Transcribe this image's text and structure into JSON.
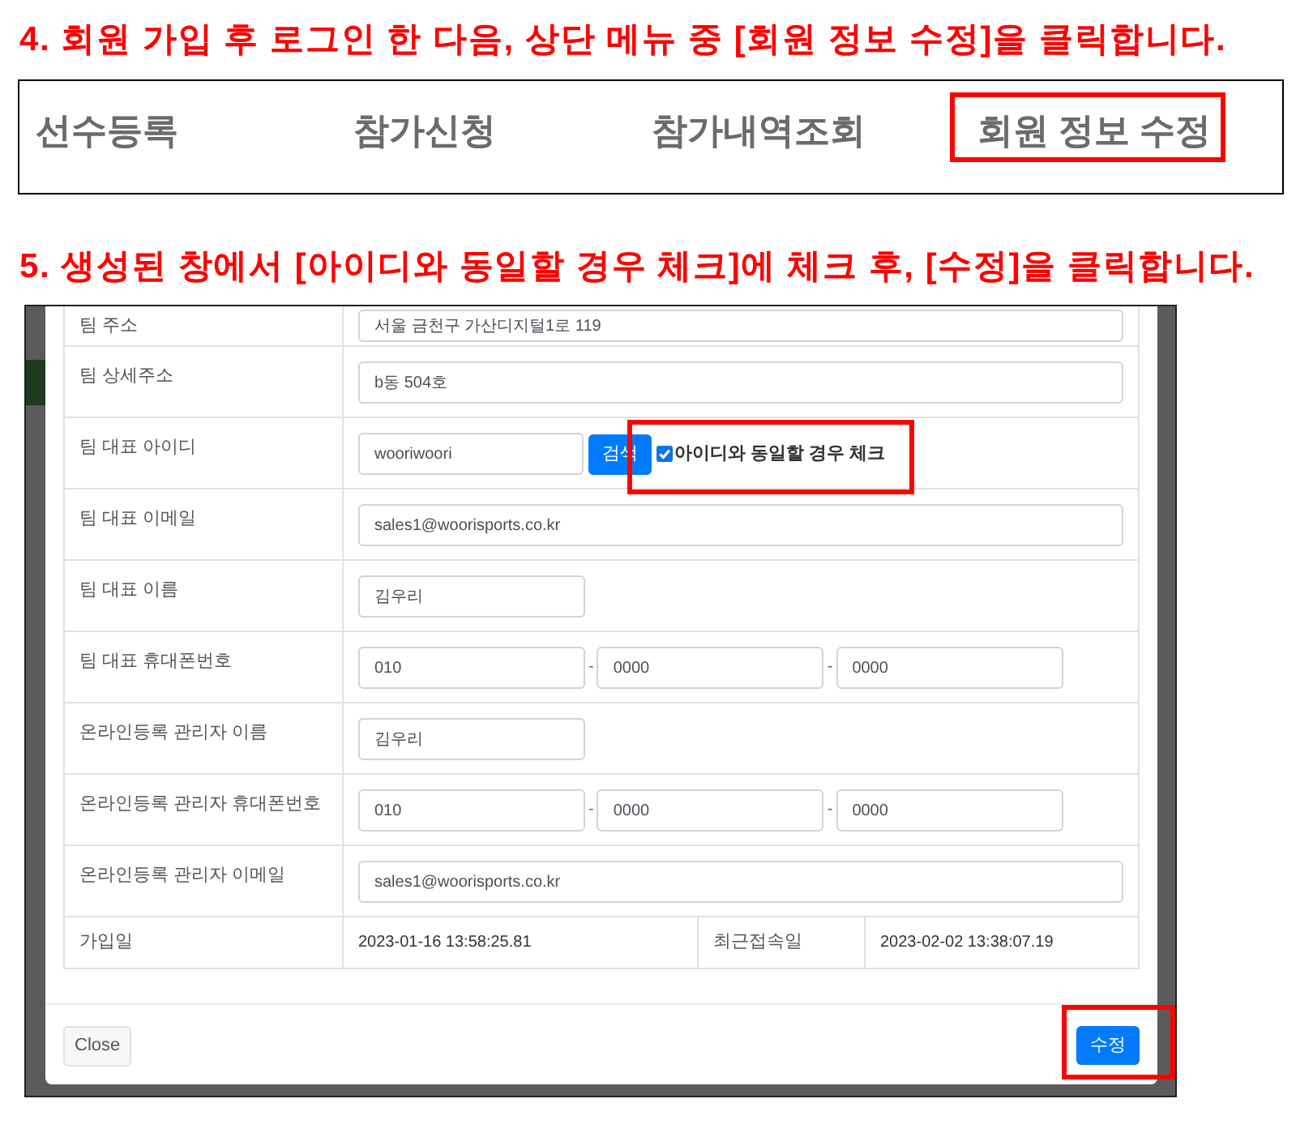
{
  "step_4": {
    "heading": "4. 회원 가입 후 로그인 한 다음, 상단 메뉴 중 [회원 정보 수정]을 클릭합니다.",
    "menu": [
      {
        "label": "선수등록",
        "highlighted": false
      },
      {
        "label": "참가신청",
        "highlighted": false
      },
      {
        "label": "참가내역조회",
        "highlighted": false
      },
      {
        "label": "회원 정보 수정",
        "highlighted": true
      }
    ]
  },
  "step_5": {
    "heading": "5. 생성된 창에서 [아이디와 동일할 경우 체크]에 체크 후, [수정]을 클릭합니다.",
    "modal": {
      "rows": [
        {
          "kind": "wide",
          "label": "팀 주소",
          "value": "서울 금천구 가산디지털1로 119"
        },
        {
          "kind": "wide",
          "label": "팀 상세주소",
          "value": "b동 504호"
        },
        {
          "kind": "id_check",
          "label": "팀 대표 아이디",
          "value": "wooriwoori",
          "button": "검색",
          "checkbox": {
            "label": "아이디와 동일할 경우 체크",
            "checked": true,
            "highlighted": true
          }
        },
        {
          "kind": "wide",
          "label": "팀 대표 이메일",
          "value": "sales1@woorisports.co.kr"
        },
        {
          "kind": "narrow",
          "label": "팀 대표 이름",
          "value": "김우리"
        },
        {
          "kind": "phone",
          "label": "팀 대표 휴대폰번호",
          "parts": [
            "010",
            "0000",
            "0000"
          ],
          "separators": [
            "-",
            "-"
          ]
        },
        {
          "kind": "narrow",
          "label": "온라인등록 관리자 이름",
          "value": "김우리"
        },
        {
          "kind": "phone",
          "label": "온라인등록 관리자 휴대폰번호",
          "parts": [
            "010",
            "0000",
            "0000"
          ],
          "separators": [
            "-",
            "-"
          ]
        },
        {
          "kind": "wide",
          "label": "온라인등록 관리자 이메일",
          "value": "sales1@woorisports.co.kr"
        },
        {
          "kind": "info",
          "cells": [
            "가입일",
            "2023-01-16 13:58:25.81",
            "최근접속일",
            "2023-02-02 13:38:07.19"
          ]
        }
      ],
      "buttons": [
        {
          "label": "Close",
          "kind": "secondary",
          "highlighted": false
        },
        {
          "label": "수정",
          "kind": "primary",
          "highlighted": true
        }
      ]
    }
  }
}
